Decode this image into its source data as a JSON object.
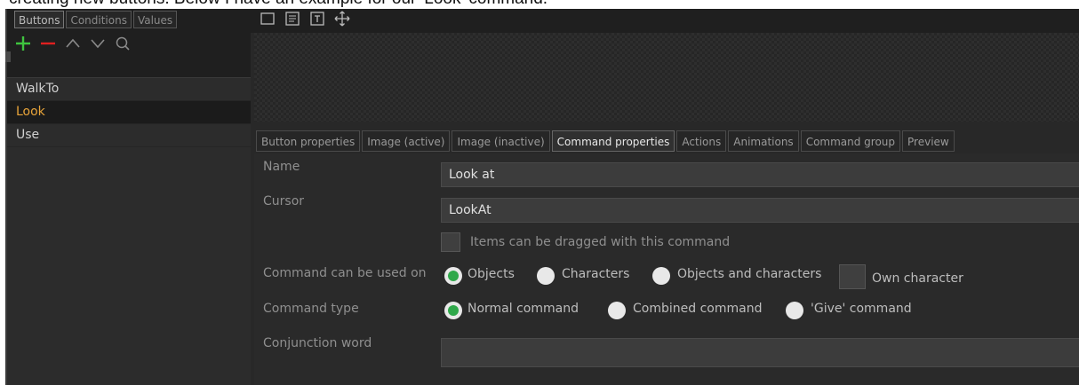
{
  "doc_text": "creating new buttons. Below I have an example for our 'Look' command.",
  "left_panel": {
    "tabs": [
      {
        "label": "Buttons",
        "active": true
      },
      {
        "label": "Conditions",
        "active": false
      },
      {
        "label": "Values",
        "active": false
      }
    ],
    "items": [
      {
        "label": "WalkTo",
        "selected": false
      },
      {
        "label": "Look",
        "selected": true
      },
      {
        "label": "Use",
        "selected": false
      }
    ]
  },
  "tabs": [
    {
      "label": "Button properties",
      "active": false
    },
    {
      "label": "Image (active)",
      "active": false
    },
    {
      "label": "Image (inactive)",
      "active": false
    },
    {
      "label": "Command properties",
      "active": true
    },
    {
      "label": "Actions",
      "active": false
    },
    {
      "label": "Animations",
      "active": false
    },
    {
      "label": "Command group",
      "active": false
    },
    {
      "label": "Preview",
      "active": false
    }
  ],
  "form": {
    "name_label": "Name",
    "name_value": "Look at",
    "cursor_label": "Cursor",
    "cursor_value": "LookAt",
    "drag_label": "Items can be dragged with this command",
    "used_on_label": "Command can be used on",
    "used_on_options": [
      "Objects",
      "Characters",
      "Objects and characters"
    ],
    "used_on_selected": "Objects",
    "own_character_label": "Own character",
    "type_label": "Command type",
    "type_options": [
      "Normal command",
      "Combined command",
      "'Give' command"
    ],
    "type_selected": "Normal command",
    "conjunction_label": "Conjunction word",
    "conjunction_value": ""
  },
  "colors": {
    "accent_selected_text": "#e8a43a",
    "radio_selected": "#2fa84a",
    "add_icon": "#3fc43f",
    "remove_icon": "#e02020"
  }
}
